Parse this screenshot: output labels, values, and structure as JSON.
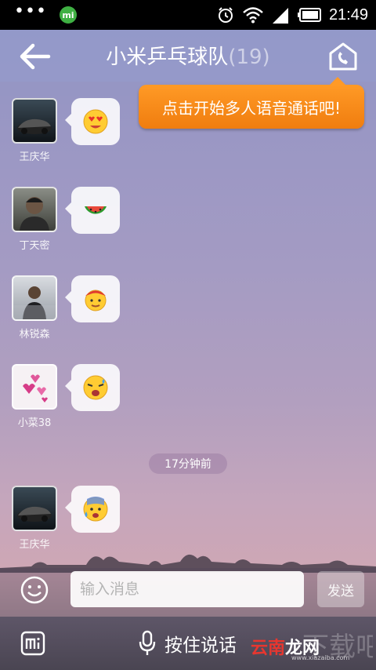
{
  "status_bar": {
    "dots": "•••",
    "mi_label": "mi",
    "time": "21:49"
  },
  "header": {
    "title": "小米乒乓球队",
    "member_count": "(19)"
  },
  "tooltip": {
    "text": "点击开始多人语音通话吧!"
  },
  "messages": [
    {
      "sender": "王庆华",
      "emoji": "heart-eyes-emoji"
    },
    {
      "sender": "丁天密",
      "emoji": "watermelon-emoji"
    },
    {
      "sender": "林锐森",
      "emoji": "cap-face-emoji"
    },
    {
      "sender": "小菜38",
      "emoji": "crying-face-emoji"
    },
    {
      "sender": "王庆华",
      "emoji": "anxious-sweat-emoji"
    }
  ],
  "time_divider": "17分钟前",
  "input_bar": {
    "placeholder": "输入消息",
    "send_label": "发送"
  },
  "bottom_bar": {
    "voice_label": "按住说话"
  },
  "watermark": {
    "text_part1": "云南",
    "text_part2": "龙网",
    "url": "www.xiazaiba.com"
  },
  "colors": {
    "tooltip": "#f28516",
    "header": "#969cce"
  }
}
